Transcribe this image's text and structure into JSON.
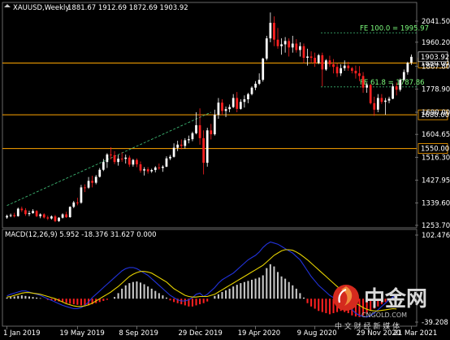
{
  "header": {
    "symbol_timeframe": "XAUUSD,Weekly",
    "ohlc": "1881.67 1912.69 1872.69 1903.92"
  },
  "chart_data": {
    "type": "candlestick",
    "symbol": "XAUUSD",
    "timeframe": "Weekly",
    "price_axis_ticks": [
      "2041.50",
      "1960.20",
      "1867.80",
      "1778.90",
      "1690.00",
      "1604.65",
      "1516.30",
      "1427.95",
      "1339.60",
      "1253.70"
    ],
    "ylim": [
      1253.7,
      2075
    ],
    "date_axis_labels": [
      "1 Jan 2019",
      "19 May 2019",
      "8 Sep 2019",
      "29 Dec 2019",
      "19 Apr 2020",
      "9 Aug 2020",
      "29 Nov 2020",
      "21 Mar 2021"
    ],
    "current_price_label": "1903.92",
    "horizontal_levels": [
      {
        "price": 1880.0,
        "label": "1880.00",
        "color": "#FFA500"
      },
      {
        "price": 1680.0,
        "label": "1680.00",
        "color": "#FFA500"
      },
      {
        "price": 1550.0,
        "label": "1550.00",
        "color": "#FFA500"
      }
    ],
    "fib_levels": [
      {
        "price": 1995.97,
        "label": "FE 100.0 = 1995.97",
        "color": "#3CB371"
      },
      {
        "price": 1787.86,
        "label": "FE 61.8 = 1787.86",
        "color": "#3CB371"
      }
    ],
    "trendline": {
      "from": {
        "week": 0,
        "price": 1330
      },
      "to": {
        "week": 55,
        "price": 1690
      },
      "color": "#3CB371",
      "style": "dashed"
    },
    "candles": [
      [
        1284,
        1295,
        1279,
        1290
      ],
      [
        1290,
        1299,
        1285,
        1293
      ],
      [
        1293,
        1302,
        1284,
        1289
      ],
      [
        1289,
        1322,
        1287,
        1318
      ],
      [
        1318,
        1326,
        1305,
        1312
      ],
      [
        1312,
        1320,
        1290,
        1297
      ],
      [
        1297,
        1310,
        1289,
        1301
      ],
      [
        1301,
        1316,
        1298,
        1309
      ],
      [
        1309,
        1312,
        1285,
        1289
      ],
      [
        1289,
        1300,
        1281,
        1296
      ],
      [
        1296,
        1300,
        1280,
        1284
      ],
      [
        1284,
        1291,
        1274,
        1280
      ],
      [
        1280,
        1292,
        1276,
        1288
      ],
      [
        1288,
        1294,
        1266,
        1270
      ],
      [
        1270,
        1285,
        1267,
        1283
      ],
      [
        1283,
        1300,
        1280,
        1296
      ],
      [
        1296,
        1306,
        1282,
        1285
      ],
      [
        1285,
        1327,
        1283,
        1325
      ],
      [
        1325,
        1348,
        1320,
        1342
      ],
      [
        1342,
        1360,
        1331,
        1341
      ],
      [
        1341,
        1410,
        1337,
        1400
      ],
      [
        1400,
        1412,
        1382,
        1399
      ],
      [
        1399,
        1440,
        1394,
        1425
      ],
      [
        1425,
        1445,
        1400,
        1418
      ],
      [
        1418,
        1448,
        1412,
        1441
      ],
      [
        1441,
        1475,
        1438,
        1468
      ],
      [
        1468,
        1510,
        1463,
        1498
      ],
      [
        1498,
        1532,
        1475,
        1527
      ],
      [
        1527,
        1555,
        1508,
        1524
      ],
      [
        1524,
        1540,
        1490,
        1498
      ],
      [
        1498,
        1525,
        1484,
        1511
      ],
      [
        1511,
        1535,
        1499,
        1510
      ],
      [
        1510,
        1527,
        1492,
        1515
      ],
      [
        1515,
        1523,
        1479,
        1488
      ],
      [
        1488,
        1510,
        1480,
        1506
      ],
      [
        1506,
        1512,
        1478,
        1489
      ],
      [
        1489,
        1500,
        1457,
        1465
      ],
      [
        1465,
        1478,
        1446,
        1470
      ],
      [
        1470,
        1478,
        1453,
        1462
      ],
      [
        1462,
        1472,
        1456,
        1467
      ],
      [
        1467,
        1482,
        1458,
        1477
      ],
      [
        1477,
        1492,
        1468,
        1475
      ],
      [
        1475,
        1485,
        1460,
        1480
      ],
      [
        1480,
        1520,
        1478,
        1512
      ],
      [
        1512,
        1525,
        1505,
        1518
      ],
      [
        1518,
        1570,
        1515,
        1553
      ],
      [
        1553,
        1580,
        1540,
        1565
      ],
      [
        1565,
        1585,
        1547,
        1560
      ],
      [
        1560,
        1590,
        1550,
        1582
      ],
      [
        1582,
        1600,
        1570,
        1586
      ],
      [
        1586,
        1615,
        1578,
        1609
      ],
      [
        1609,
        1690,
        1605,
        1640
      ],
      [
        1640,
        1705,
        1565,
        1590
      ],
      [
        1590,
        1620,
        1450,
        1495
      ],
      [
        1495,
        1630,
        1480,
        1620
      ],
      [
        1620,
        1645,
        1585,
        1605
      ],
      [
        1605,
        1700,
        1600,
        1680
      ],
      [
        1680,
        1745,
        1665,
        1727
      ],
      [
        1727,
        1740,
        1680,
        1695
      ],
      [
        1695,
        1712,
        1671,
        1702
      ],
      [
        1702,
        1720,
        1690,
        1710
      ],
      [
        1710,
        1760,
        1706,
        1745
      ],
      [
        1745,
        1768,
        1690,
        1703
      ],
      [
        1703,
        1740,
        1700,
        1730
      ],
      [
        1730,
        1755,
        1708,
        1740
      ],
      [
        1740,
        1765,
        1725,
        1760
      ],
      [
        1760,
        1790,
        1755,
        1785
      ],
      [
        1785,
        1810,
        1775,
        1800
      ],
      [
        1800,
        1840,
        1795,
        1815
      ],
      [
        1815,
        1900,
        1808,
        1897
      ],
      [
        1897,
        1985,
        1890,
        1975
      ],
      [
        1975,
        2075,
        1960,
        2035
      ],
      [
        2035,
        2060,
        1945,
        1970
      ],
      [
        1970,
        2015,
        1935,
        1945
      ],
      [
        1945,
        1975,
        1912,
        1952
      ],
      [
        1952,
        1980,
        1920,
        1965
      ],
      [
        1965,
        1975,
        1905,
        1940
      ],
      [
        1940,
        1985,
        1920,
        1955
      ],
      [
        1955,
        1972,
        1920,
        1930
      ],
      [
        1930,
        1960,
        1905,
        1945
      ],
      [
        1945,
        1955,
        1880,
        1900
      ],
      [
        1900,
        1935,
        1870,
        1905
      ],
      [
        1905,
        1925,
        1880,
        1900
      ],
      [
        1900,
        1920,
        1865,
        1880
      ],
      [
        1880,
        1915,
        1875,
        1910
      ],
      [
        1910,
        1920,
        1790,
        1855
      ],
      [
        1855,
        1895,
        1850,
        1890
      ],
      [
        1890,
        1908,
        1865,
        1875
      ],
      [
        1875,
        1895,
        1840,
        1865
      ],
      [
        1865,
        1880,
        1826,
        1840
      ],
      [
        1840,
        1875,
        1830,
        1860
      ],
      [
        1860,
        1890,
        1850,
        1870
      ],
      [
        1870,
        1885,
        1850,
        1860
      ],
      [
        1860,
        1865,
        1840,
        1850
      ],
      [
        1850,
        1870,
        1820,
        1840
      ],
      [
        1840,
        1868,
        1810,
        1830
      ],
      [
        1830,
        1845,
        1765,
        1785
      ],
      [
        1785,
        1805,
        1765,
        1795
      ],
      [
        1795,
        1800,
        1720,
        1725
      ],
      [
        1725,
        1750,
        1676,
        1700
      ],
      [
        1700,
        1760,
        1690,
        1745
      ],
      [
        1745,
        1760,
        1722,
        1730
      ],
      [
        1730,
        1745,
        1680,
        1735
      ],
      [
        1735,
        1750,
        1725,
        1742
      ],
      [
        1742,
        1800,
        1740,
        1790
      ],
      [
        1790,
        1805,
        1755,
        1777
      ],
      [
        1777,
        1820,
        1770,
        1815
      ],
      [
        1815,
        1855,
        1810,
        1845
      ],
      [
        1845,
        1885,
        1835,
        1880
      ],
      [
        1881.67,
        1912.69,
        1872.69,
        1903.92
      ]
    ],
    "macd": {
      "label": "MACD(12,26,9) 5.952 -18.376 31.627 0.000",
      "params": "12,26,9",
      "main": 5.952,
      "signal": -18.376,
      "axis_ticks": [
        "102.476",
        "-39.208"
      ],
      "ylim": [
        -45,
        110
      ],
      "histogram": [
        2,
        3,
        4,
        5,
        6,
        5,
        4,
        3,
        2,
        1,
        0,
        -2,
        -3,
        -4,
        -5,
        -6,
        -8,
        -9,
        -10,
        -11,
        -12,
        -13,
        -12,
        -10,
        -8,
        -6,
        -4,
        -2,
        0,
        3,
        10,
        18,
        24,
        28,
        30,
        31,
        29,
        26,
        22,
        18,
        14,
        10,
        6,
        2,
        -3,
        -6,
        -8,
        -10,
        -12,
        -14,
        -14,
        -12,
        -10,
        -8,
        -5,
        0,
        5,
        8,
        12,
        15,
        18,
        22,
        25,
        28,
        30,
        32,
        34,
        36,
        38,
        42,
        55,
        62,
        58,
        48,
        40,
        36,
        30,
        24,
        18,
        10,
        2,
        -8,
        -14,
        -18,
        -22,
        -24,
        -26,
        -28,
        -26,
        -24,
        -22,
        -24,
        -26,
        -30,
        -32,
        -33,
        -30,
        -27,
        -22,
        -18,
        -14,
        -10,
        -6,
        -2,
        2,
        5
      ],
      "main_line": [
        5,
        8,
        10,
        12,
        14,
        14,
        12,
        10,
        8,
        6,
        3,
        0,
        -3,
        -6,
        -9,
        -12,
        -14,
        -16,
        -18,
        -18,
        -16,
        -12,
        -6,
        2,
        8,
        14,
        20,
        26,
        32,
        38,
        44,
        50,
        54,
        56,
        56,
        54,
        50,
        46,
        42,
        36,
        30,
        24,
        18,
        12,
        6,
        2,
        -2,
        -4,
        -4,
        -2,
        2,
        8,
        10,
        4,
        8,
        14,
        20,
        28,
        34,
        38,
        42,
        46,
        52,
        58,
        64,
        70,
        74,
        78,
        84,
        92,
        98,
        102,
        100,
        98,
        94,
        90,
        86,
        82,
        76,
        70,
        60,
        50,
        40,
        32,
        24,
        18,
        12,
        6,
        2,
        -2,
        -6,
        -10,
        -14,
        -20,
        -26,
        -30,
        -32,
        -33,
        -30,
        -26,
        -20,
        -14,
        -8,
        -2,
        3,
        6
      ],
      "signal_line": [
        3,
        4,
        6,
        8,
        10,
        11,
        11,
        10,
        9,
        8,
        6,
        4,
        2,
        0,
        -3,
        -6,
        -9,
        -11,
        -13,
        -14,
        -14,
        -13,
        -11,
        -8,
        -4,
        0,
        4,
        8,
        12,
        17,
        22,
        28,
        34,
        40,
        44,
        47,
        49,
        49,
        48,
        46,
        42,
        38,
        34,
        30,
        24,
        18,
        14,
        10,
        6,
        4,
        3,
        3,
        4,
        4,
        4,
        6,
        8,
        12,
        16,
        20,
        24,
        28,
        32,
        36,
        40,
        44,
        48,
        52,
        56,
        60,
        66,
        72,
        78,
        82,
        86,
        88,
        88,
        87,
        84,
        80,
        75,
        70,
        64,
        58,
        52,
        46,
        40,
        34,
        28,
        22,
        16,
        10,
        4,
        -2,
        -8,
        -12,
        -16,
        -19,
        -21,
        -22,
        -22,
        -21,
        -20,
        -19,
        -18,
        -18.4
      ]
    }
  },
  "colors": {
    "background": "#000000",
    "grid": "#2a2a2a",
    "up_candle": "#FFFFFF",
    "down_candle": "#FF2020",
    "level_line": "#FFA500",
    "fib_line": "#3CB371",
    "macd_main": "#2233DD",
    "macd_signal": "#E6D200",
    "hist_up": "#C8C8C8",
    "hist_down": "#FF2020",
    "axis_text": "#FFFFFF",
    "label_box_bg": "#000000"
  },
  "watermark": {
    "brand_cn": "中金网",
    "site": "CNGOLD.COM",
    "slogan": "中 文 财 经 新 媒 体"
  }
}
